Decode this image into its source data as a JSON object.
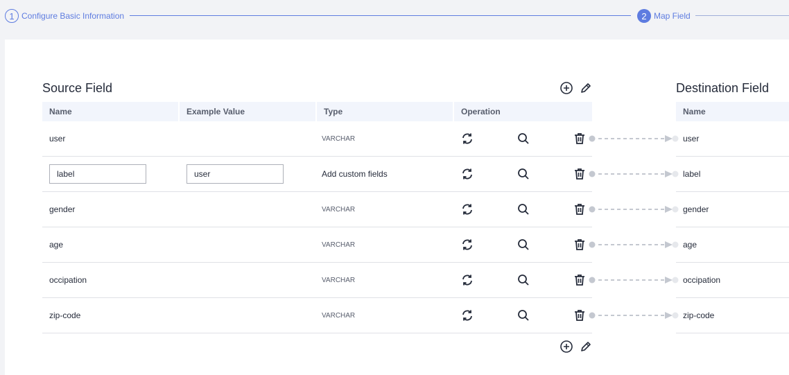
{
  "stepper": {
    "steps": [
      {
        "number": "1",
        "label": "Configure Basic Information"
      },
      {
        "number": "2",
        "label": "Map Field"
      }
    ]
  },
  "source": {
    "title": "Source Field",
    "columns": {
      "name": "Name",
      "example": "Example Value",
      "type": "Type",
      "operation": "Operation"
    },
    "rows": [
      {
        "name": "user",
        "type": "VARCHAR"
      },
      {
        "name_input": "label",
        "example_input": "user",
        "type": "Add custom fields"
      },
      {
        "name": "gender",
        "type": "VARCHAR"
      },
      {
        "name": "age",
        "type": "VARCHAR"
      },
      {
        "name": "occipation",
        "type": "VARCHAR"
      },
      {
        "name": "zip-code",
        "type": "VARCHAR"
      }
    ]
  },
  "destination": {
    "title": "Destination Field",
    "columns": {
      "name": "Name"
    },
    "rows": [
      "user",
      "label",
      "gender",
      "age",
      "occipation",
      "zip-code"
    ]
  },
  "icons": {
    "add": "add-circle-icon",
    "edit": "edit-pencil-icon",
    "sync": "sync-icon",
    "search": "search-icon",
    "delete": "trash-icon"
  },
  "colors": {
    "accent": "#5e7ce0",
    "header_bg": "#f2f5fc",
    "page_bg": "#f2f3f6"
  }
}
